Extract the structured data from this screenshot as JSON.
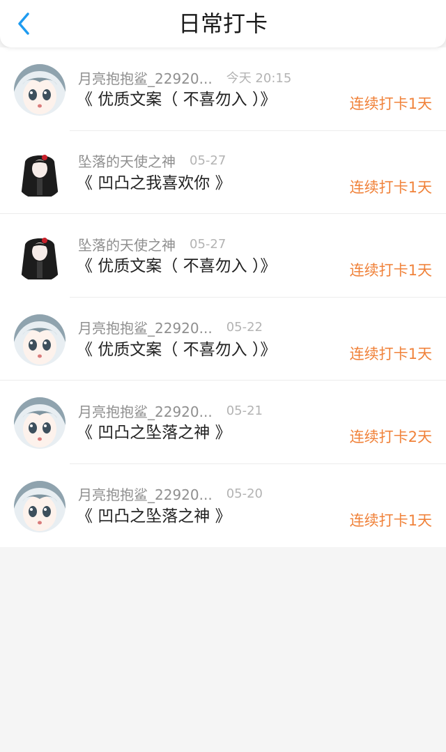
{
  "header": {
    "title": "日常打卡",
    "back_icon": "chevron-left-icon",
    "accent_color": "#1e9bf0"
  },
  "colors": {
    "streak": "#f0823a",
    "username": "#8f8f8f",
    "time": "#b3b3b3"
  },
  "entries": [
    {
      "user": "月亮抱抱鲨_22920...",
      "time": "今天 20:15",
      "title": "《 优质文案（ 不喜勿入 ）》",
      "streak": "连续打卡1天",
      "avatar": "anime-girl-blue-hair-avatar"
    },
    {
      "user": "坠落的天使之神",
      "time": "05-27",
      "title": "《 凹凸之我喜欢你 》",
      "streak": "连续打卡1天",
      "avatar": "anime-girl-black-hair-avatar"
    },
    {
      "user": "坠落的天使之神",
      "time": "05-27",
      "title": "《 优质文案（ 不喜勿入 ）》",
      "streak": "连续打卡1天",
      "avatar": "anime-girl-black-hair-avatar"
    },
    {
      "user": "月亮抱抱鲨_22920...",
      "time": "05-22",
      "title": "《 优质文案（ 不喜勿入 ）》",
      "streak": "连续打卡1天",
      "avatar": "anime-girl-blue-hair-avatar"
    },
    {
      "user": "月亮抱抱鲨_22920...",
      "time": "05-21",
      "title": "《 凹凸之坠落之神 》",
      "streak": "连续打卡2天",
      "avatar": "anime-girl-blue-hair-avatar"
    },
    {
      "user": "月亮抱抱鲨_22920...",
      "time": "05-20",
      "title": "《 凹凸之坠落之神 》",
      "streak": "连续打卡1天",
      "avatar": "anime-girl-blue-hair-avatar"
    }
  ]
}
